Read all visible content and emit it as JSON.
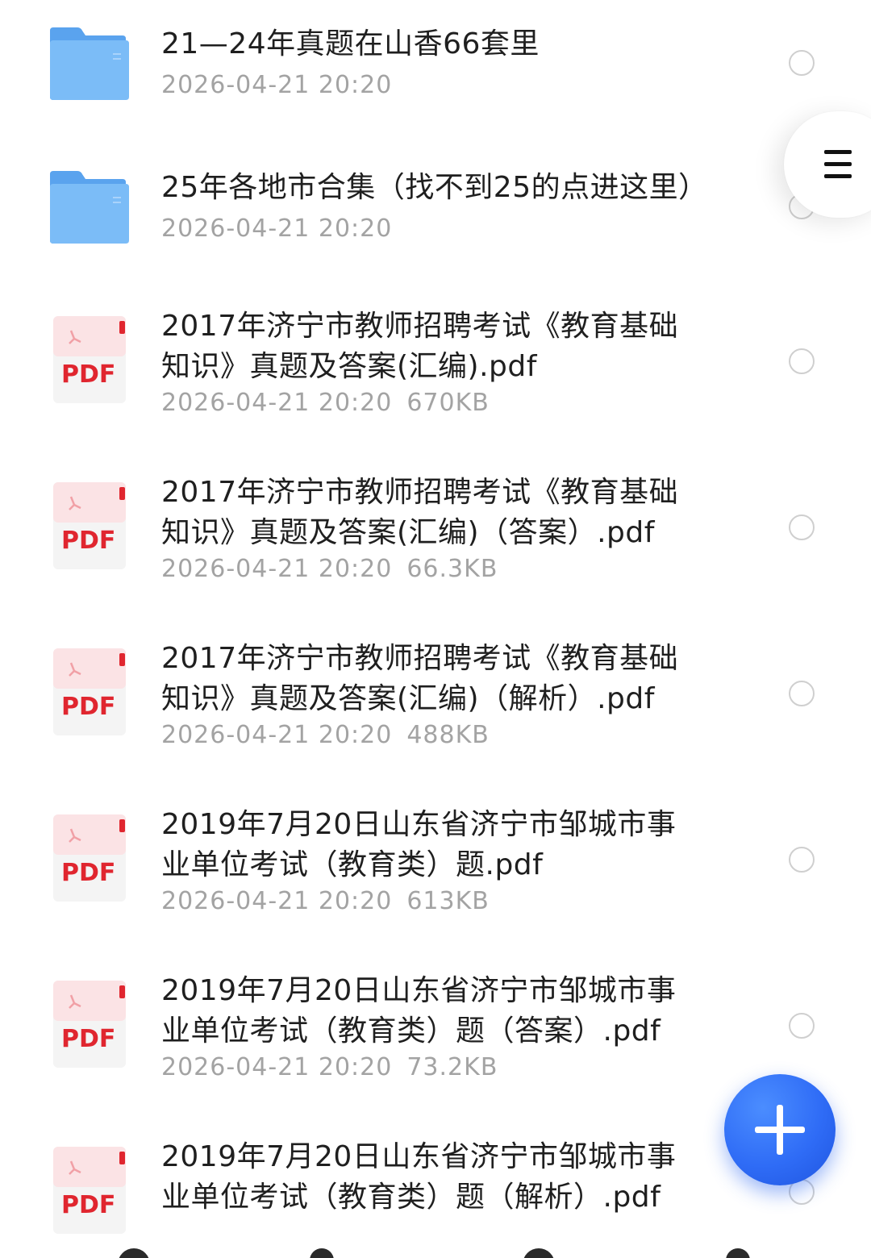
{
  "files": [
    {
      "type": "folder",
      "icon": "folder-icon",
      "title": "21—24年真题在山香66套里",
      "date": "2026-04-21 20:20",
      "size": ""
    },
    {
      "type": "folder",
      "icon": "folder-icon",
      "title": "25年各地市合集（找不到25的点进这里）",
      "date": "2026-04-21 20:20",
      "size": ""
    },
    {
      "type": "pdf",
      "icon": "pdf-file-icon",
      "badge": "PDF",
      "title": "2017年济宁市教师招聘考试《教育基础知识》真题及答案(汇编).pdf",
      "date": "2026-04-21 20:20",
      "size": "670KB"
    },
    {
      "type": "pdf",
      "icon": "pdf-file-icon",
      "badge": "PDF",
      "title": "2017年济宁市教师招聘考试《教育基础知识》真题及答案(汇编)（答案）.pdf",
      "date": "2026-04-21 20:20",
      "size": "66.3KB"
    },
    {
      "type": "pdf",
      "icon": "pdf-file-icon",
      "badge": "PDF",
      "title": "2017年济宁市教师招聘考试《教育基础知识》真题及答案(汇编)（解析）.pdf",
      "date": "2026-04-21 20:20",
      "size": "488KB"
    },
    {
      "type": "pdf",
      "icon": "pdf-file-icon",
      "badge": "PDF",
      "title": "2019年7月20日山东省济宁市邹城市事业单位考试（教育类）题.pdf",
      "date": "2026-04-21 20:20",
      "size": "613KB"
    },
    {
      "type": "pdf",
      "icon": "pdf-file-icon",
      "badge": "PDF",
      "title": "2019年7月20日山东省济宁市邹城市事业单位考试（教育类）题（答案）.pdf",
      "date": "2026-04-21 20:20",
      "size": "73.2KB"
    },
    {
      "type": "pdf",
      "icon": "pdf-file-icon",
      "badge": "PDF",
      "title": "2019年7月20日山东省济宁市邹城市事业单位考试（教育类）题（解析）.pdf",
      "date": "",
      "size": ""
    }
  ],
  "menu": {
    "icon": "hamburger-menu-icon"
  },
  "fab": {
    "icon": "plus-icon"
  },
  "colors": {
    "folder_blue": "#6fb3f5",
    "pdf_red": "#e0262f",
    "fab_blue": "#2f6cf6",
    "text_primary": "#1f1f1f",
    "text_secondary": "#a3a3a3"
  }
}
